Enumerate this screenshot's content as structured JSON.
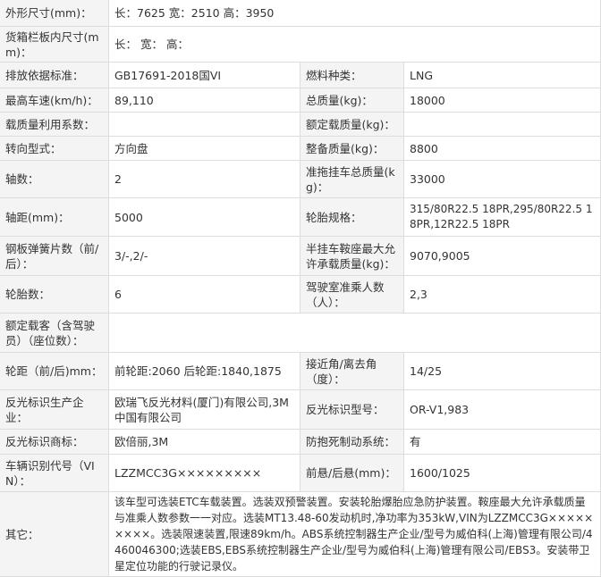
{
  "specs": {
    "dimensions": {
      "label": "外形尺寸(mm)：",
      "value": "长：7625 宽：2510 高：3950"
    },
    "cargo_box": {
      "label": "货箱栏板内尺寸(mm)：",
      "value": "长： 宽： 高："
    },
    "emission_std": {
      "label": "排放依据标准：",
      "value": "GB17691-2018国VI"
    },
    "fuel_type": {
      "label": "燃料种类：",
      "value": "LNG"
    },
    "max_speed": {
      "label": "最高车速(km/h)：",
      "value": "89,110"
    },
    "total_mass": {
      "label": "总质量(kg)：",
      "value": "18000"
    },
    "load_util": {
      "label": "载质量利用系数：",
      "value": ""
    },
    "rated_load": {
      "label": "额定载质量(kg)：",
      "value": ""
    },
    "steering": {
      "label": "转向型式：",
      "value": "方向盘"
    },
    "curb_mass": {
      "label": "整备质量(kg)：",
      "value": "8800"
    },
    "axles": {
      "label": "轴数：",
      "value": "2"
    },
    "trailer_mass": {
      "label": "准拖挂车总质量(kg)：",
      "value": "33000"
    },
    "wheelbase": {
      "label": "轴距(mm)：",
      "value": "5000"
    },
    "tire_spec": {
      "label": "轮胎规格：",
      "value": "315/80R22.5 18PR,295/80R22.5 18PR,12R22.5 18PR"
    },
    "leaf_springs": {
      "label": "钢板弹簧片数（前/后）：",
      "value": "3/-,2/-"
    },
    "saddle_load": {
      "label": "半挂车鞍座最大允许承载质量(kg)：",
      "value": "9070,9005"
    },
    "tires_count": {
      "label": "轮胎数：",
      "value": "6"
    },
    "cab_passengers": {
      "label": "驾驶室准乘人数（人）：",
      "value": "2,3"
    },
    "rated_passengers": {
      "label": "额定载客（含驾驶员）（座位数）：",
      "value": ""
    },
    "track": {
      "label": "轮距（前/后)mm：",
      "value": "前轮距:2060 后轮距:1840,1875"
    },
    "angles": {
      "label": "接近角/离去角（度）：",
      "value": "14/25"
    },
    "reflector_maker": {
      "label": "反光标识生产企业：",
      "value": "欧瑞飞反光材料(厦门)有限公司,3M中国有限公司"
    },
    "reflector_model": {
      "label": "反光标识型号：",
      "value": "OR-V1,983"
    },
    "reflector_brand": {
      "label": "反光标识商标：",
      "value": "欧倍丽,3M"
    },
    "abs": {
      "label": "防抱死制动系统：",
      "value": "有"
    },
    "vin": {
      "label": "车辆识别代号（VIN）：",
      "value": "LZZMCC3G×××××××××"
    },
    "overhang": {
      "label": "前悬/后悬(mm)：",
      "value": "1600/1025"
    },
    "other": {
      "label": "其它：",
      "value": "该车型可选装ETC车载装置。选装双预警装置。安装轮胎爆胎应急防护装置。鞍座最大允许承载质量与准乘人数参数一一对应。选装MT13.48-60发动机时,净功率为353kW,VIN为LZZMCC3G×××××××××。选装限速装置,限速89km/h。ABS系统控制器生产企业/型号为威伯科(上海)管理有限公司/4460046300;选装EBS,EBS系统控制器生产企业/型号为威伯科(上海)管理有限公司/EBS3。安装带卫星定位功能的行驶记录仪。"
    }
  }
}
